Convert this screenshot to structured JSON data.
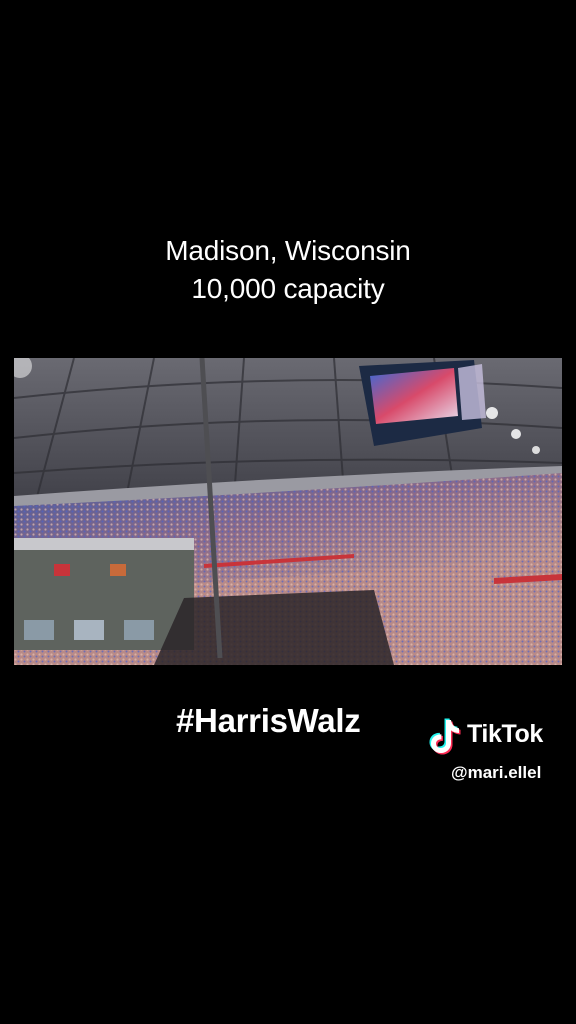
{
  "caption": {
    "line1": "Madison, Wisconsin",
    "line2": "10,000 capacity"
  },
  "overlay": {
    "hashtag": "#HarrisWalz"
  },
  "watermark": {
    "brand": "TikTok",
    "handle": "@mari.ellel",
    "logo_icon": "tiktok-note-icon"
  },
  "colors": {
    "background": "#000000",
    "text": "#ffffff",
    "tiktok_cyan": "#25F4EE",
    "tiktok_red": "#FE2C55"
  }
}
